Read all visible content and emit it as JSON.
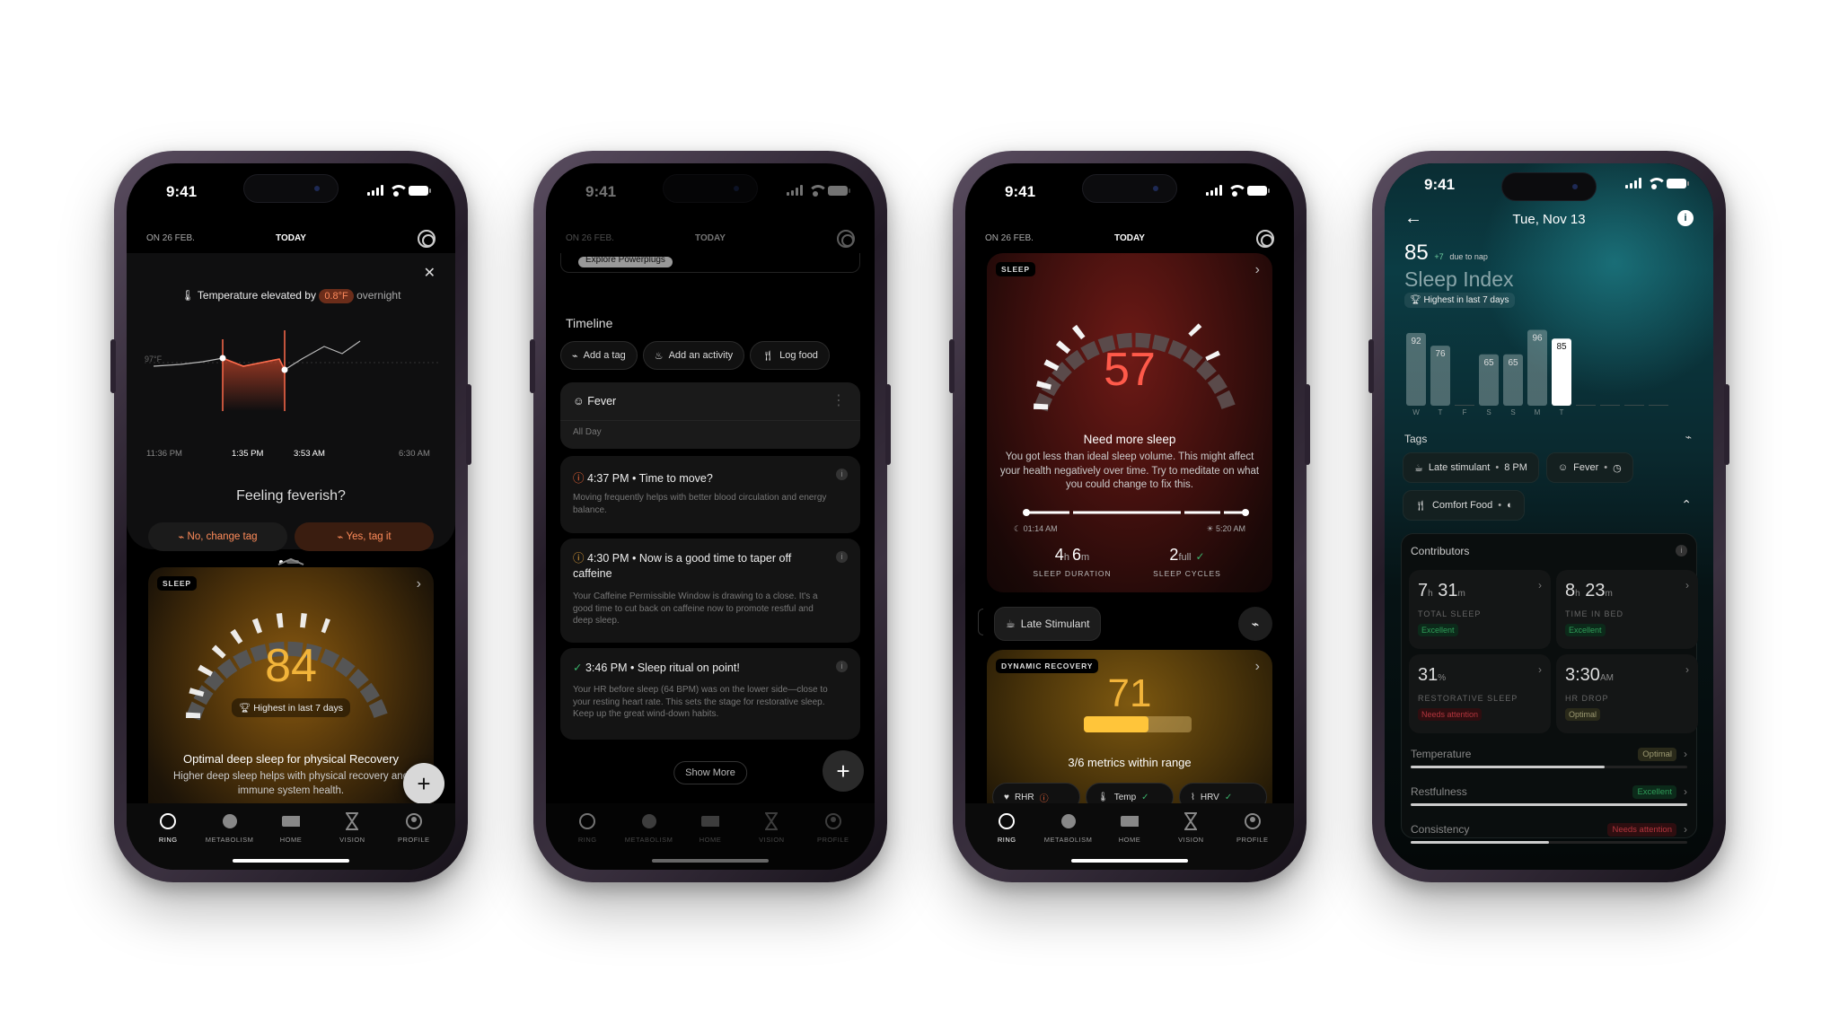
{
  "status": {
    "time": "9:41"
  },
  "dates": {
    "prev": "ON 26 FEB.",
    "today": "TODAY"
  },
  "tabs": [
    "RING",
    "METABOLISM",
    "HOME",
    "VISION",
    "PROFILE"
  ],
  "phone1": {
    "temp_prefix": "Temperature elevated by",
    "temp_value": "0.8°F",
    "temp_suffix": "overnight",
    "chart_ref": "97°F",
    "chart_data": {
      "type": "line",
      "x": [
        "11:36 PM",
        "1:35 PM",
        "3:53 AM",
        "6:30 AM"
      ],
      "ref_label": "97°F",
      "highlight_range": [
        "1:35 PM",
        "3:53 AM"
      ]
    },
    "question": "Feeling feverish?",
    "btn_no": "No, change tag",
    "btn_yes": "Yes, tag it",
    "sleep_badge": "SLEEP",
    "sleep_score": "84",
    "sleep_pill": "Highest in last 7 days",
    "sleep_title": "Optimal deep sleep for physical Recovery",
    "sleep_body": "Higher deep sleep helps with physical recovery and immune system health."
  },
  "phone2": {
    "explore": "Explore Powerplugs",
    "timeline": "Timeline",
    "chips": [
      "Add a tag",
      "Add an activity",
      "Log food"
    ],
    "fever_title": "Fever",
    "fever_sub": "All Day",
    "items": [
      {
        "title": "4:37 PM • Time to move?",
        "body": "Moving frequently helps with better blood circulation and energy balance."
      },
      {
        "title": "4:30 PM • Now is a good time to taper off caffeine",
        "body": "Your Caffeine Permissible Window is drawing to a close. It's a good time to cut back on caffeine now to promote restful and deep sleep."
      },
      {
        "title": "3:46 PM • Sleep ritual on point!",
        "body": "Your HR before sleep (64 BPM) was on the lower side—close to your resting heart rate. This sets the stage for restorative sleep. Keep up the great wind-down habits."
      }
    ],
    "show_more": "Show More"
  },
  "phone3": {
    "sleep_badge": "SLEEP",
    "score": "57",
    "title": "Need more sleep",
    "body": "You got less than ideal sleep volume. This might affect your health negatively over time. Try to meditate on what you could change to fix this.",
    "start": "01:14 AM",
    "end": "5:20 AM",
    "duration_h": "4",
    "duration_m": "6",
    "duration_label": "SLEEP DURATION",
    "cycles_n": "2",
    "cycles_word": "full",
    "cycles_label": "SLEEP CYCLES",
    "stimulant": "Late Stimulant",
    "recovery_badge": "DYNAMIC RECOVERY",
    "recovery_score": "71",
    "recovery_level": 0.6,
    "recovery_text": "3/6 metrics within range",
    "mini": [
      "RHR",
      "Temp",
      "HRV"
    ]
  },
  "phone4": {
    "date": "Tue, Nov 13",
    "score": "85",
    "delta": "+7",
    "delta_note": "due to nap",
    "title": "Sleep Index",
    "pill": "Highest in last 7 days",
    "chart_data": {
      "type": "bar",
      "categories": [
        "W",
        "T",
        "F",
        "S",
        "S",
        "M",
        "T"
      ],
      "values": [
        92,
        76,
        null,
        65,
        65,
        96,
        85
      ]
    },
    "tags_label": "Tags",
    "tags": [
      {
        "label": "Late stimulant",
        "time": "8 PM"
      },
      {
        "label": "Fever"
      },
      {
        "label": "Comfort Food"
      }
    ],
    "contributors": "Contributors",
    "tiles": [
      {
        "big1": "7",
        "u1": "h",
        "big2": "31",
        "u2": "m",
        "label": "TOTAL SLEEP",
        "status": "Excellent",
        "kind": "ex"
      },
      {
        "big1": "8",
        "u1": "h",
        "big2": "23",
        "u2": "m",
        "label": "TIME IN BED",
        "status": "Excellent",
        "kind": "ex"
      },
      {
        "big1": "31",
        "u1": "%",
        "big2": "",
        "u2": "",
        "label": "RESTORATIVE SLEEP",
        "status": "Needs attention",
        "kind": "na"
      },
      {
        "big1": "3:30",
        "u1": "AM",
        "big2": "",
        "u2": "",
        "label": "HR DROP",
        "status": "Optimal",
        "kind": "op"
      }
    ],
    "metrics": [
      {
        "label": "Temperature",
        "status": "Optimal",
        "kind": "op",
        "level": 0.7
      },
      {
        "label": "Restfulness",
        "status": "Excellent",
        "kind": "ex",
        "level": 1.0
      },
      {
        "label": "Consistency",
        "status": "Needs attention",
        "kind": "na",
        "level": 0.5
      }
    ]
  },
  "colors": {
    "orange": "#ff8c5a",
    "gold": "#f2b43a",
    "red": "#ff5a4a",
    "green": "#2f9d58",
    "teal": "#0b3c44"
  }
}
